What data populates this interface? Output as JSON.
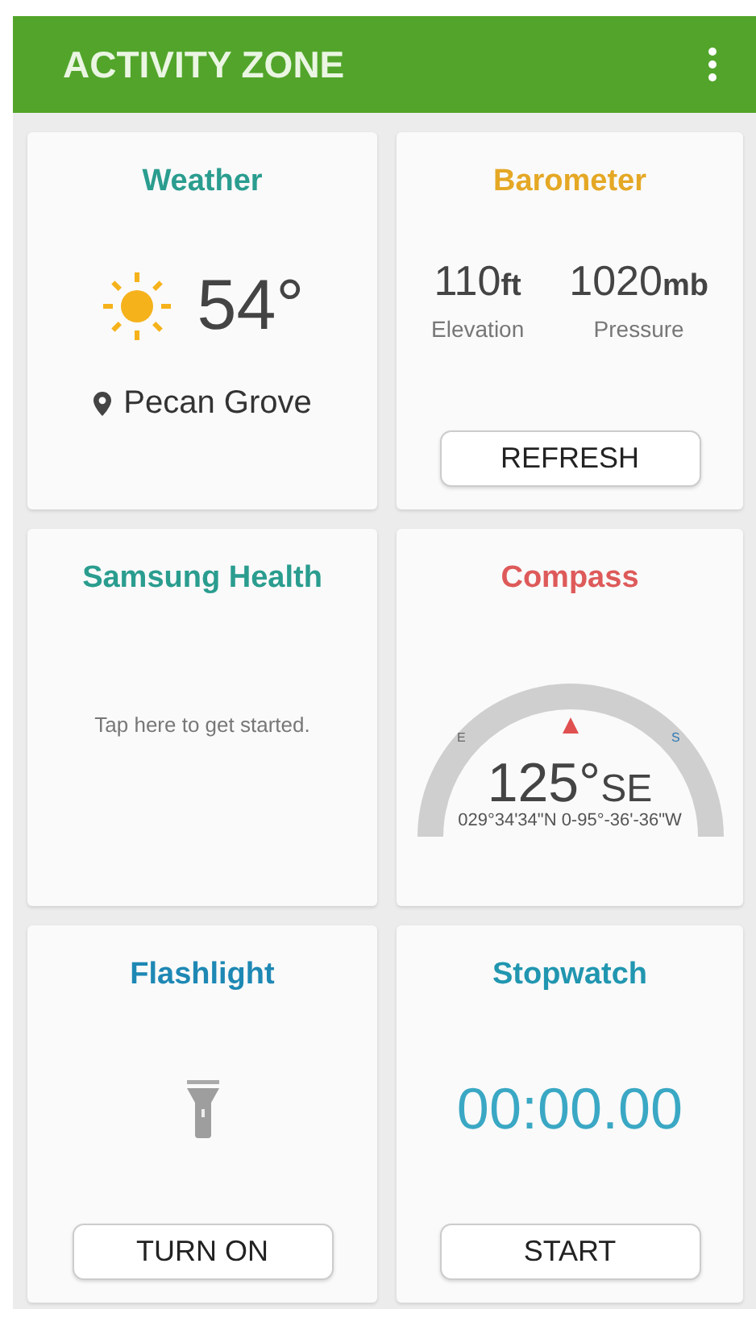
{
  "app_bar": {
    "title": "ACTIVITY ZONE"
  },
  "cards": [
    {
      "kind": "weather",
      "title": "Weather",
      "color": "#2a9d8f",
      "temperature": "54°",
      "location": "Pecan Grove"
    },
    {
      "kind": "barometer",
      "title": "Barometer",
      "color": "#e5a825",
      "readings": [
        {
          "value": "110",
          "unit": "ft",
          "label": "Elevation"
        },
        {
          "value": "1020",
          "unit": "mb",
          "label": "Pressure"
        }
      ],
      "button": "REFRESH"
    },
    {
      "kind": "health",
      "title": "Samsung Health",
      "color": "#2a9d8f",
      "message": "Tap here to get started."
    },
    {
      "kind": "compass",
      "title": "Compass",
      "color": "#de5a5a",
      "heading": "125°",
      "direction": "SE",
      "coordinates": "029°34'34\"N 0-95°-36'-36\"W",
      "marks": [
        "E",
        "S"
      ]
    },
    {
      "kind": "flashlight",
      "title": "Flashlight",
      "color": "#1e88b4",
      "button": "TURN ON"
    },
    {
      "kind": "stopwatch",
      "title": "Stopwatch",
      "color": "#2196b0",
      "time": "00:00.00",
      "button": "START"
    }
  ]
}
